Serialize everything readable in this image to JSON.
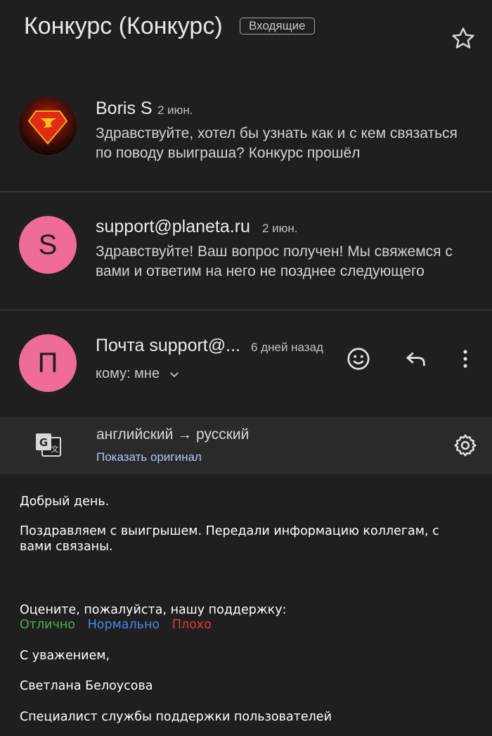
{
  "header": {
    "subject": "Конкурс  (Конкурс)",
    "label": "Входящие",
    "star_icon": "star-outline-icon"
  },
  "messages": [
    {
      "sender": "Boris S",
      "date": "2 июн.",
      "snippet": "Здравствуйте, хотел бы узнать как и с кем связаться по поводу выиграша? Конкурс прошёл",
      "avatar": "superman-logo-avatar"
    },
    {
      "sender": "support@planeta.ru",
      "date": "2 июн.",
      "snippet": "Здравствуйте! Ваш вопрос получен! Мы свяжемся с вами и ответим на него не позднее следующего",
      "avatar_letter": "S",
      "avatar_color": "#ee6b9a"
    }
  ],
  "open_message": {
    "sender": "Почта support@...",
    "date": "6 дней назад",
    "to": "кому: мне",
    "avatar_letter": "П",
    "avatar_color": "#ee6b9a",
    "actions": [
      "emoji-reaction-icon",
      "reply-icon",
      "more-vert-icon"
    ]
  },
  "translation": {
    "languages": "английский → русский",
    "show_original": "Показать оригинал",
    "accent": "#a8c7fa"
  },
  "body": {
    "greeting": "Добрый день.",
    "paragraph": "Поздравляем с выигрышем. Передали информацию коллегам, с вами связаны.",
    "rating_prompt": "Оцените, пожалуйста, нашу поддержку:",
    "rating_excellent": "Отлично",
    "rating_normal": "Нормально",
    "rating_bad": "Плохо",
    "rating_colors": {
      "excellent": "#4caf50",
      "normal": "#4a86e8",
      "bad": "#e53935"
    },
    "regards": "С уважением,",
    "signature_name": "Светлана Белоусова",
    "signature_title": "Специалист службы поддержки пользователей"
  }
}
